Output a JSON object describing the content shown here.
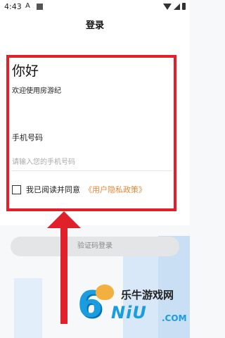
{
  "status_bar": {
    "time": "4:43",
    "notification_letter": "A"
  },
  "header": {
    "title": "登录"
  },
  "intro": {
    "greeting": "你好",
    "welcome": "欢迎使用房游纪"
  },
  "form": {
    "phone_label": "手机号码",
    "phone_placeholder": "请输入您的手机号码",
    "phone_value": "",
    "agree_text": "我已阅读并同意",
    "policy_link": "《用户隐私政策》"
  },
  "actions": {
    "login_button": "验证码登录"
  },
  "watermark": {
    "logo_char": "6",
    "title": "乐牛游戏网",
    "sub": "NiU",
    "domain": ".COM"
  },
  "colors": {
    "highlight": "#e0202b",
    "link": "#e8873a",
    "brand_blue": "#1a9de0"
  }
}
